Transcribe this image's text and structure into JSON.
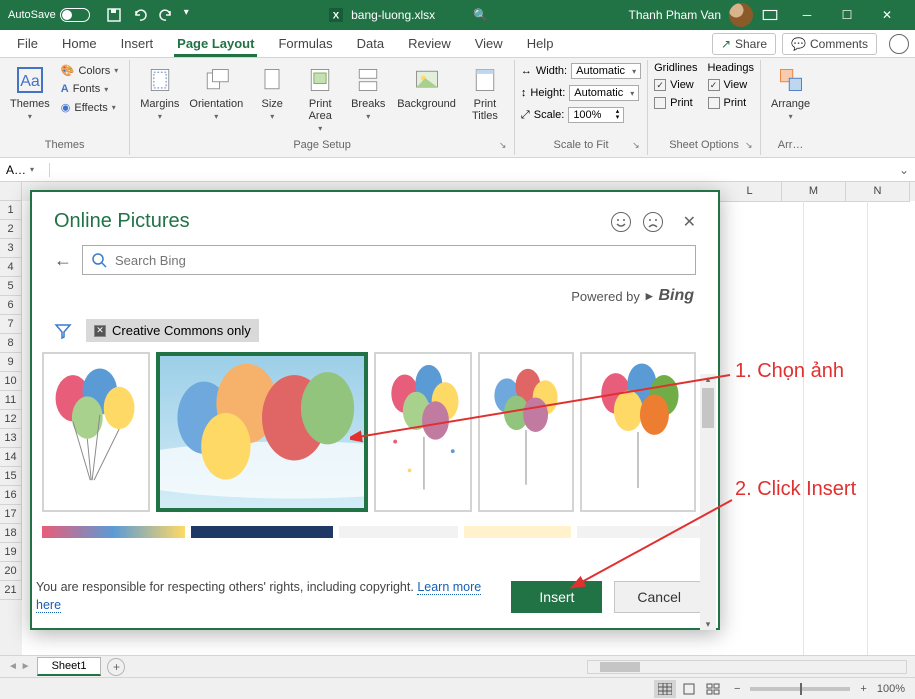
{
  "titlebar": {
    "autosave_label": "AutoSave",
    "autosave_state": "Off",
    "filename": "bang-luong.xlsx",
    "username": "Thanh Pham Van"
  },
  "tabs": {
    "file": "File",
    "home": "Home",
    "insert": "Insert",
    "page_layout": "Page Layout",
    "formulas": "Formulas",
    "data": "Data",
    "review": "Review",
    "view": "View",
    "help": "Help",
    "share": "Share",
    "comments": "Comments"
  },
  "ribbon": {
    "themes": {
      "group": "Themes",
      "themes": "Themes",
      "colors": "Colors",
      "fonts": "Fonts",
      "effects": "Effects"
    },
    "page_setup": {
      "group": "Page Setup",
      "margins": "Margins",
      "orientation": "Orientation",
      "size": "Size",
      "print_area": "Print\nArea",
      "breaks": "Breaks",
      "background": "Background",
      "print_titles": "Print\nTitles"
    },
    "scale": {
      "group": "Scale to Fit",
      "width": "Width:",
      "height": "Height:",
      "scale": "Scale:",
      "auto": "Automatic",
      "scale_val": "100%"
    },
    "sheet_options": {
      "group": "Sheet Options",
      "gridlines": "Gridlines",
      "headings": "Headings",
      "view": "View",
      "print": "Print"
    },
    "arrange": {
      "group": "Arr…",
      "arrange": "Arrange"
    }
  },
  "name_box": "A…",
  "columns": [
    "L",
    "M",
    "N"
  ],
  "rows": [
    "1",
    "2",
    "3",
    "4",
    "5",
    "6",
    "7",
    "8",
    "9",
    "10",
    "11",
    "12",
    "13",
    "14",
    "15",
    "16",
    "17",
    "18",
    "19",
    "20",
    "21"
  ],
  "dialog": {
    "title": "Online Pictures",
    "search_placeholder": "Search Bing",
    "powered_by": "Powered by",
    "bing": "Bing",
    "cc_only": "Creative Commons only",
    "footer_text": "You are responsible for respecting others' rights, including copyright.",
    "learn_more": "Learn more here",
    "insert": "Insert",
    "cancel": "Cancel"
  },
  "annotations": {
    "step1": "1. Chọn ảnh",
    "step2": "2. Click Insert"
  },
  "sheet_tab": "Sheet1",
  "zoom": "100%"
}
